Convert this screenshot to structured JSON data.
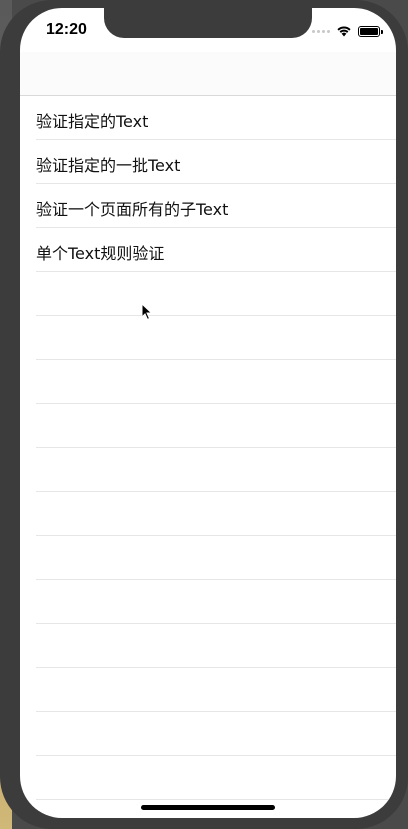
{
  "status_bar": {
    "time": "12:20",
    "icons": [
      "signal-icon",
      "wifi-icon",
      "battery-icon"
    ]
  },
  "table": {
    "rows": [
      {
        "label": "验证指定的Text"
      },
      {
        "label": "验证指定的一批Text"
      },
      {
        "label": "验证一个页面所有的子Text"
      },
      {
        "label": "单个Text规则验证"
      },
      {
        "label": ""
      },
      {
        "label": ""
      },
      {
        "label": ""
      },
      {
        "label": ""
      },
      {
        "label": ""
      },
      {
        "label": ""
      },
      {
        "label": ""
      },
      {
        "label": ""
      },
      {
        "label": ""
      },
      {
        "label": ""
      },
      {
        "label": ""
      },
      {
        "label": ""
      }
    ]
  },
  "colors": {
    "frame": "#3c3c3c",
    "screen": "#ffffff",
    "separator": "#e6e6e6",
    "text": "#111111"
  }
}
